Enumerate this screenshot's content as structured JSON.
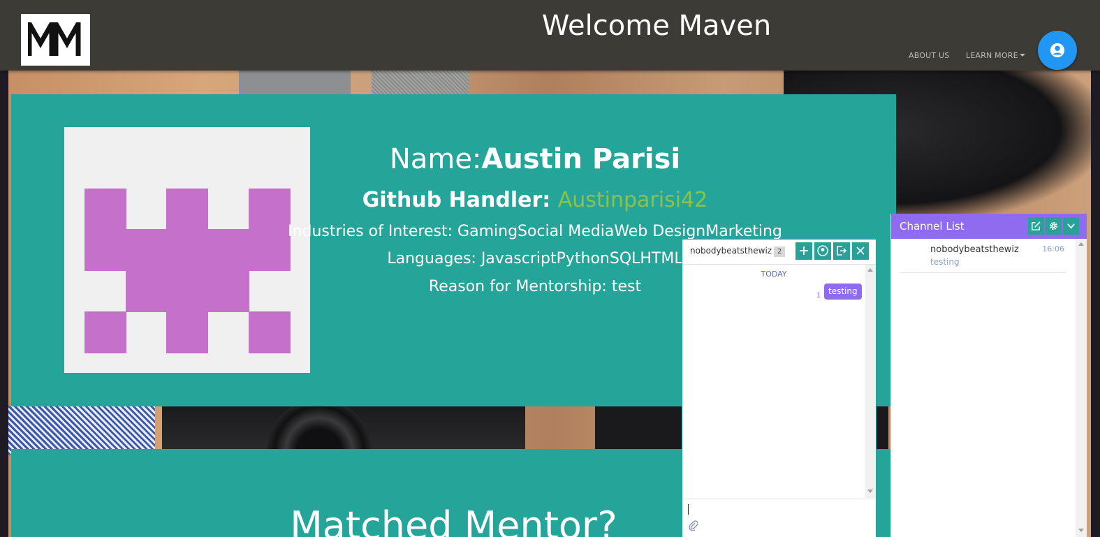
{
  "header": {
    "title": "Welcome Maven",
    "logo_text": "MM",
    "nav": {
      "about": "ABOUT US",
      "learn_more": "LEARN MORE"
    },
    "account_icon": "account-circle-icon",
    "bar_color": "#3c3b36",
    "accent_color": "#2196f3"
  },
  "profile": {
    "name_label": "Name:",
    "name": "Austin Parisi",
    "github_label": "Github Handler:",
    "github_handle": "Austinparisi42",
    "industries": "Industries of Interest: GamingSocial MediaWeb DesignMarketing",
    "languages": "Languages: JavascriptPythonSQLHTML",
    "reason": "Reason for Mentorship: test",
    "card_color": "#25a59a",
    "identicon_color": "#c571cc"
  },
  "mentor": {
    "title": "Matched Mentor?"
  },
  "chat": {
    "channel_name": "nobodybeatsthewiz",
    "member_count": "2",
    "day_separator": "TODAY",
    "messages": [
      {
        "text": "testing",
        "unread_count": "1"
      }
    ],
    "buttons": [
      "add-icon",
      "members-icon",
      "leave-icon",
      "close-icon"
    ],
    "accent_color": "#2aa197",
    "bubble_color": "#8e6bef"
  },
  "channel_list": {
    "title": "Channel List",
    "header_color": "#8e6bef",
    "items": [
      {
        "name": "nobodybeatsthewiz",
        "time": "16:06",
        "last_message": "testing"
      }
    ]
  }
}
